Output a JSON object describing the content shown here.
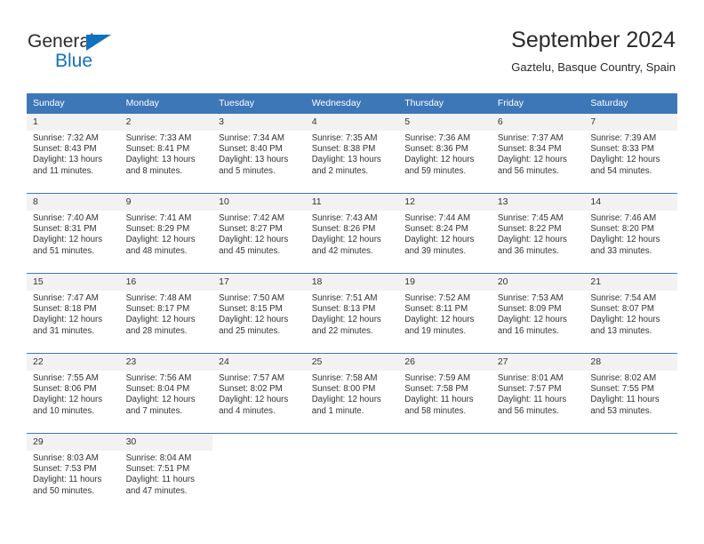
{
  "brand": {
    "name_part1": "General",
    "name_part2": "Blue",
    "color_primary": "#1271bd",
    "color_text": "#2b2b2b"
  },
  "header": {
    "title": "September 2024",
    "location": "Gaztelu, Basque Country, Spain"
  },
  "theme": {
    "header_row_bg": "#3d77b8",
    "daynum_bg": "#f2f2f2",
    "row_border": "#3d77b8",
    "body_text": "#333333"
  },
  "weekday_headers": [
    "Sunday",
    "Monday",
    "Tuesday",
    "Wednesday",
    "Thursday",
    "Friday",
    "Saturday"
  ],
  "weeks": [
    [
      {
        "day": "1",
        "sunrise": "Sunrise: 7:32 AM",
        "sunset": "Sunset: 8:43 PM",
        "daylight_line1": "Daylight: 13 hours",
        "daylight_line2": "and 11 minutes."
      },
      {
        "day": "2",
        "sunrise": "Sunrise: 7:33 AM",
        "sunset": "Sunset: 8:41 PM",
        "daylight_line1": "Daylight: 13 hours",
        "daylight_line2": "and 8 minutes."
      },
      {
        "day": "3",
        "sunrise": "Sunrise: 7:34 AM",
        "sunset": "Sunset: 8:40 PM",
        "daylight_line1": "Daylight: 13 hours",
        "daylight_line2": "and 5 minutes."
      },
      {
        "day": "4",
        "sunrise": "Sunrise: 7:35 AM",
        "sunset": "Sunset: 8:38 PM",
        "daylight_line1": "Daylight: 13 hours",
        "daylight_line2": "and 2 minutes."
      },
      {
        "day": "5",
        "sunrise": "Sunrise: 7:36 AM",
        "sunset": "Sunset: 8:36 PM",
        "daylight_line1": "Daylight: 12 hours",
        "daylight_line2": "and 59 minutes."
      },
      {
        "day": "6",
        "sunrise": "Sunrise: 7:37 AM",
        "sunset": "Sunset: 8:34 PM",
        "daylight_line1": "Daylight: 12 hours",
        "daylight_line2": "and 56 minutes."
      },
      {
        "day": "7",
        "sunrise": "Sunrise: 7:39 AM",
        "sunset": "Sunset: 8:33 PM",
        "daylight_line1": "Daylight: 12 hours",
        "daylight_line2": "and 54 minutes."
      }
    ],
    [
      {
        "day": "8",
        "sunrise": "Sunrise: 7:40 AM",
        "sunset": "Sunset: 8:31 PM",
        "daylight_line1": "Daylight: 12 hours",
        "daylight_line2": "and 51 minutes."
      },
      {
        "day": "9",
        "sunrise": "Sunrise: 7:41 AM",
        "sunset": "Sunset: 8:29 PM",
        "daylight_line1": "Daylight: 12 hours",
        "daylight_line2": "and 48 minutes."
      },
      {
        "day": "10",
        "sunrise": "Sunrise: 7:42 AM",
        "sunset": "Sunset: 8:27 PM",
        "daylight_line1": "Daylight: 12 hours",
        "daylight_line2": "and 45 minutes."
      },
      {
        "day": "11",
        "sunrise": "Sunrise: 7:43 AM",
        "sunset": "Sunset: 8:26 PM",
        "daylight_line1": "Daylight: 12 hours",
        "daylight_line2": "and 42 minutes."
      },
      {
        "day": "12",
        "sunrise": "Sunrise: 7:44 AM",
        "sunset": "Sunset: 8:24 PM",
        "daylight_line1": "Daylight: 12 hours",
        "daylight_line2": "and 39 minutes."
      },
      {
        "day": "13",
        "sunrise": "Sunrise: 7:45 AM",
        "sunset": "Sunset: 8:22 PM",
        "daylight_line1": "Daylight: 12 hours",
        "daylight_line2": "and 36 minutes."
      },
      {
        "day": "14",
        "sunrise": "Sunrise: 7:46 AM",
        "sunset": "Sunset: 8:20 PM",
        "daylight_line1": "Daylight: 12 hours",
        "daylight_line2": "and 33 minutes."
      }
    ],
    [
      {
        "day": "15",
        "sunrise": "Sunrise: 7:47 AM",
        "sunset": "Sunset: 8:18 PM",
        "daylight_line1": "Daylight: 12 hours",
        "daylight_line2": "and 31 minutes."
      },
      {
        "day": "16",
        "sunrise": "Sunrise: 7:48 AM",
        "sunset": "Sunset: 8:17 PM",
        "daylight_line1": "Daylight: 12 hours",
        "daylight_line2": "and 28 minutes."
      },
      {
        "day": "17",
        "sunrise": "Sunrise: 7:50 AM",
        "sunset": "Sunset: 8:15 PM",
        "daylight_line1": "Daylight: 12 hours",
        "daylight_line2": "and 25 minutes."
      },
      {
        "day": "18",
        "sunrise": "Sunrise: 7:51 AM",
        "sunset": "Sunset: 8:13 PM",
        "daylight_line1": "Daylight: 12 hours",
        "daylight_line2": "and 22 minutes."
      },
      {
        "day": "19",
        "sunrise": "Sunrise: 7:52 AM",
        "sunset": "Sunset: 8:11 PM",
        "daylight_line1": "Daylight: 12 hours",
        "daylight_line2": "and 19 minutes."
      },
      {
        "day": "20",
        "sunrise": "Sunrise: 7:53 AM",
        "sunset": "Sunset: 8:09 PM",
        "daylight_line1": "Daylight: 12 hours",
        "daylight_line2": "and 16 minutes."
      },
      {
        "day": "21",
        "sunrise": "Sunrise: 7:54 AM",
        "sunset": "Sunset: 8:07 PM",
        "daylight_line1": "Daylight: 12 hours",
        "daylight_line2": "and 13 minutes."
      }
    ],
    [
      {
        "day": "22",
        "sunrise": "Sunrise: 7:55 AM",
        "sunset": "Sunset: 8:06 PM",
        "daylight_line1": "Daylight: 12 hours",
        "daylight_line2": "and 10 minutes."
      },
      {
        "day": "23",
        "sunrise": "Sunrise: 7:56 AM",
        "sunset": "Sunset: 8:04 PM",
        "daylight_line1": "Daylight: 12 hours",
        "daylight_line2": "and 7 minutes."
      },
      {
        "day": "24",
        "sunrise": "Sunrise: 7:57 AM",
        "sunset": "Sunset: 8:02 PM",
        "daylight_line1": "Daylight: 12 hours",
        "daylight_line2": "and 4 minutes."
      },
      {
        "day": "25",
        "sunrise": "Sunrise: 7:58 AM",
        "sunset": "Sunset: 8:00 PM",
        "daylight_line1": "Daylight: 12 hours",
        "daylight_line2": "and 1 minute."
      },
      {
        "day": "26",
        "sunrise": "Sunrise: 7:59 AM",
        "sunset": "Sunset: 7:58 PM",
        "daylight_line1": "Daylight: 11 hours",
        "daylight_line2": "and 58 minutes."
      },
      {
        "day": "27",
        "sunrise": "Sunrise: 8:01 AM",
        "sunset": "Sunset: 7:57 PM",
        "daylight_line1": "Daylight: 11 hours",
        "daylight_line2": "and 56 minutes."
      },
      {
        "day": "28",
        "sunrise": "Sunrise: 8:02 AM",
        "sunset": "Sunset: 7:55 PM",
        "daylight_line1": "Daylight: 11 hours",
        "daylight_line2": "and 53 minutes."
      }
    ],
    [
      {
        "day": "29",
        "sunrise": "Sunrise: 8:03 AM",
        "sunset": "Sunset: 7:53 PM",
        "daylight_line1": "Daylight: 11 hours",
        "daylight_line2": "and 50 minutes."
      },
      {
        "day": "30",
        "sunrise": "Sunrise: 8:04 AM",
        "sunset": "Sunset: 7:51 PM",
        "daylight_line1": "Daylight: 11 hours",
        "daylight_line2": "and 47 minutes."
      },
      {
        "day": "",
        "sunrise": "",
        "sunset": "",
        "daylight_line1": "",
        "daylight_line2": ""
      },
      {
        "day": "",
        "sunrise": "",
        "sunset": "",
        "daylight_line1": "",
        "daylight_line2": ""
      },
      {
        "day": "",
        "sunrise": "",
        "sunset": "",
        "daylight_line1": "",
        "daylight_line2": ""
      },
      {
        "day": "",
        "sunrise": "",
        "sunset": "",
        "daylight_line1": "",
        "daylight_line2": ""
      },
      {
        "day": "",
        "sunrise": "",
        "sunset": "",
        "daylight_line1": "",
        "daylight_line2": ""
      }
    ]
  ]
}
